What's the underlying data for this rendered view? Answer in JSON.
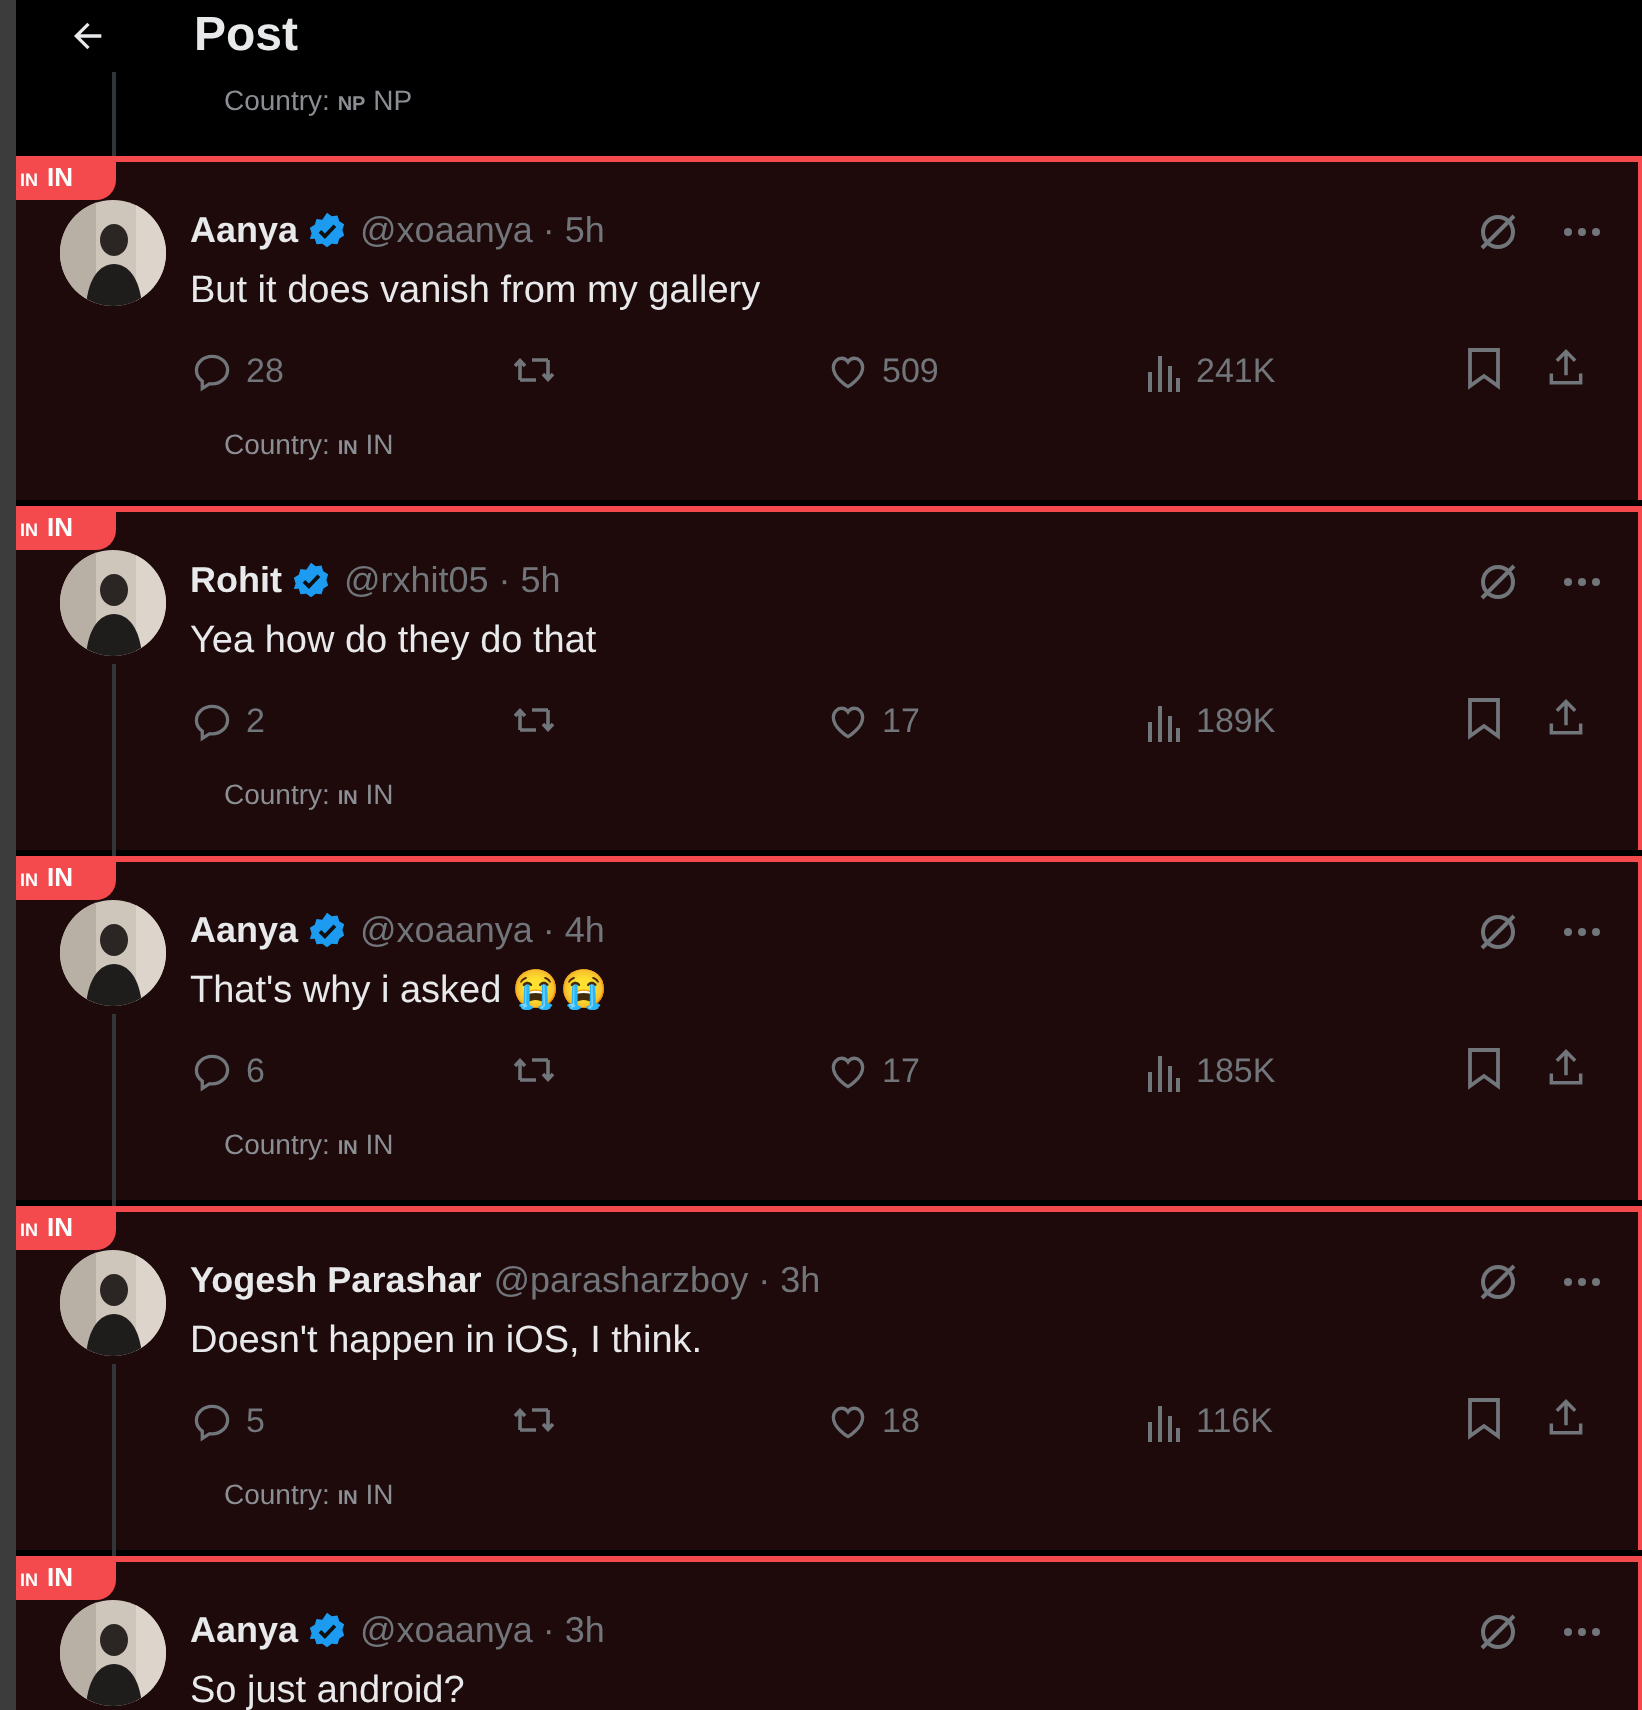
{
  "header": {
    "title": "Post"
  },
  "previous_post": {
    "country_label": "Country:",
    "flag": "NP",
    "country": "NP"
  },
  "posts": [
    {
      "badge_flag": "IN",
      "badge_code": "IN",
      "author": "Aanya",
      "verified": true,
      "meta": "@xoaanya · 5h",
      "text": "But it does vanish from my gallery",
      "thread_line": false,
      "replies": "28",
      "likes": "509",
      "views": "241K",
      "country_label": "Country:",
      "flag": "IN",
      "country": "IN"
    },
    {
      "badge_flag": "IN",
      "badge_code": "IN",
      "author": "Rohit",
      "verified": true,
      "meta": "@rxhit05 · 5h",
      "text": "Yea how do they do that",
      "thread_line": true,
      "replies": "2",
      "likes": "17",
      "views": "189K",
      "country_label": "Country:",
      "flag": "IN",
      "country": "IN"
    },
    {
      "badge_flag": "IN",
      "badge_code": "IN",
      "author": "Aanya",
      "verified": true,
      "meta": "@xoaanya · 4h",
      "text": "That's why i asked 😭😭",
      "thread_line": true,
      "replies": "6",
      "likes": "17",
      "views": "185K",
      "country_label": "Country:",
      "flag": "IN",
      "country": "IN"
    },
    {
      "badge_flag": "IN",
      "badge_code": "IN",
      "author": "Yogesh Parashar",
      "verified": false,
      "meta": "@parasharzboy · 3h",
      "text": "Doesn't happen in iOS, I think.",
      "thread_line": true,
      "replies": "5",
      "likes": "18",
      "views": "116K",
      "country_label": "Country:",
      "flag": "IN",
      "country": "IN"
    },
    {
      "badge_flag": "IN",
      "badge_code": "IN",
      "author": "Aanya",
      "verified": true,
      "meta": "@xoaanya · 3h",
      "text": "So just android?",
      "thread_line": false
    }
  ]
}
